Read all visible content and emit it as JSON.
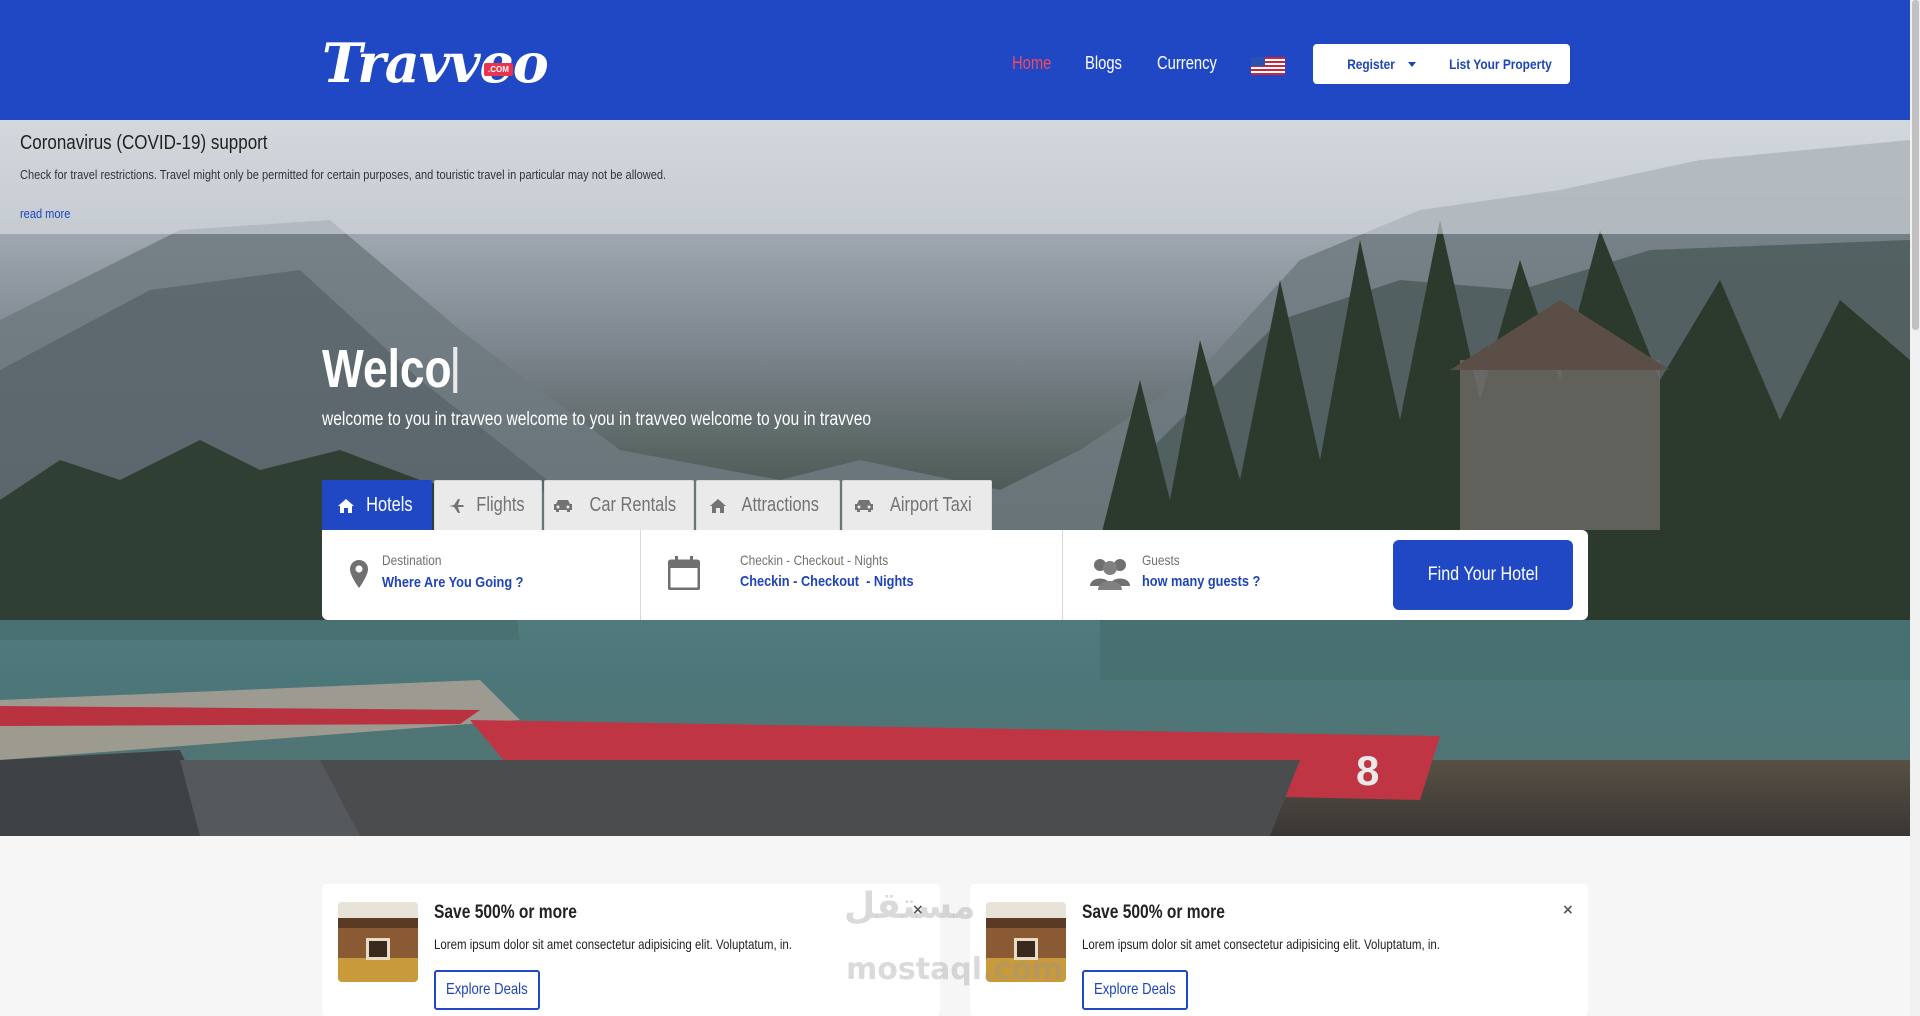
{
  "brand": {
    "logo": "Travveo",
    "logo_badge": ".COM"
  },
  "nav": {
    "home": "Home",
    "blogs": "Blogs",
    "currency": "Currency",
    "flag_icon": "us-flag-icon",
    "register": "Register",
    "list_property": "List Your Property"
  },
  "covid": {
    "title": "Coronavirus (COVID-19) support",
    "text": "Check for travel restrictions. Travel might only be permitted for certain purposes, and touristic travel in particular may not be allowed.",
    "link": "read more"
  },
  "hero": {
    "title": "Welco",
    "subtitle": "welcome to you in travveo welcome to you in travveo welcome to you in travveo"
  },
  "tabs": [
    {
      "label": "Hotels",
      "icon": "home-icon"
    },
    {
      "label": "Flights",
      "icon": "plane-icon"
    },
    {
      "label": "Car Rentals",
      "icon": "car-icon"
    },
    {
      "label": "Attractions",
      "icon": "home-icon"
    },
    {
      "label": "Airport Taxi",
      "icon": "car-icon"
    }
  ],
  "search": {
    "destination_label": "Destination",
    "destination_value": "Where Are You Going ?",
    "dates_label": "Checkin - Checkout - Nights",
    "checkin": "Checkin",
    "checkout": "Checkout",
    "nights": "Nights",
    "sep": "-",
    "guests_label": "Guests",
    "guests_value": "how many guests ?",
    "find_button": "Find Your Hotel"
  },
  "deals": [
    {
      "title": "Save 500% or more",
      "text": "Lorem ipsum dolor sit amet consectetur adipisicing elit. Voluptatum, in.",
      "button": "Explore Deals",
      "close": "×"
    },
    {
      "title": "Save 500% or more",
      "text": "Lorem ipsum dolor sit amet consectetur adipisicing elit. Voluptatum, in.",
      "button": "Explore Deals",
      "close": "×"
    }
  ],
  "watermark": {
    "arabic": "مستقل",
    "latin": "mostaql.com"
  },
  "colors": {
    "primary": "#2048c5",
    "active_nav": "#f3495f"
  }
}
